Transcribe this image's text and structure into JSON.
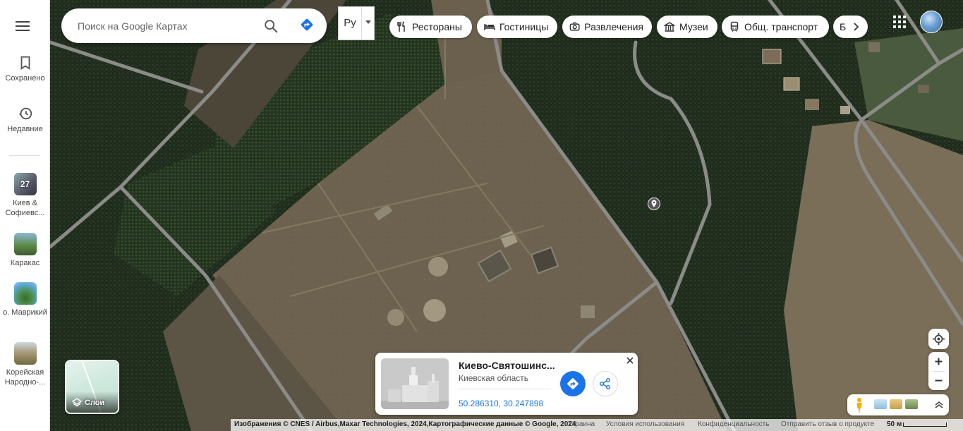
{
  "sidebar": {
    "saved_label": "Сохранено",
    "recent_label": "Недавние",
    "recents": [
      {
        "label": "Киев & Софиевс...",
        "badge": "27"
      },
      {
        "label": "Каракас"
      },
      {
        "label": "о. Маврикий"
      },
      {
        "label": "Корейская Народно-..."
      }
    ]
  },
  "search": {
    "placeholder": "Поиск на Google Картах",
    "value": ""
  },
  "language": {
    "label": "Ру"
  },
  "chips": [
    {
      "label": "Рестораны",
      "icon": "restaurant-icon"
    },
    {
      "label": "Гостиницы",
      "icon": "hotel-icon"
    },
    {
      "label": "Развлечения",
      "icon": "camera-icon"
    },
    {
      "label": "Музеи",
      "icon": "museum-icon"
    },
    {
      "label": "Общ. транспорт",
      "icon": "transit-icon"
    },
    {
      "label": "Б",
      "icon": "pharmacy-icon"
    }
  ],
  "layers_label": "Слои",
  "place_card": {
    "title": "Киево-Святошинс...",
    "subtitle": "Киевская область",
    "coordinates": "50.286310, 30.247898"
  },
  "footer": {
    "attribution": "Изображения © CNES / Airbus,Maxar Technologies, 2024,Картографические данные © Google, 2024",
    "country": "Украина",
    "terms": "Условия использования",
    "privacy": "Конфиденциальность",
    "feedback": "Отправить отзыв о продукте",
    "scale": "50 м"
  },
  "colors": {
    "accent": "#1a73e8",
    "forest": "#1f2a1a",
    "field": "#6e6350",
    "road": "#8a8a8a"
  }
}
